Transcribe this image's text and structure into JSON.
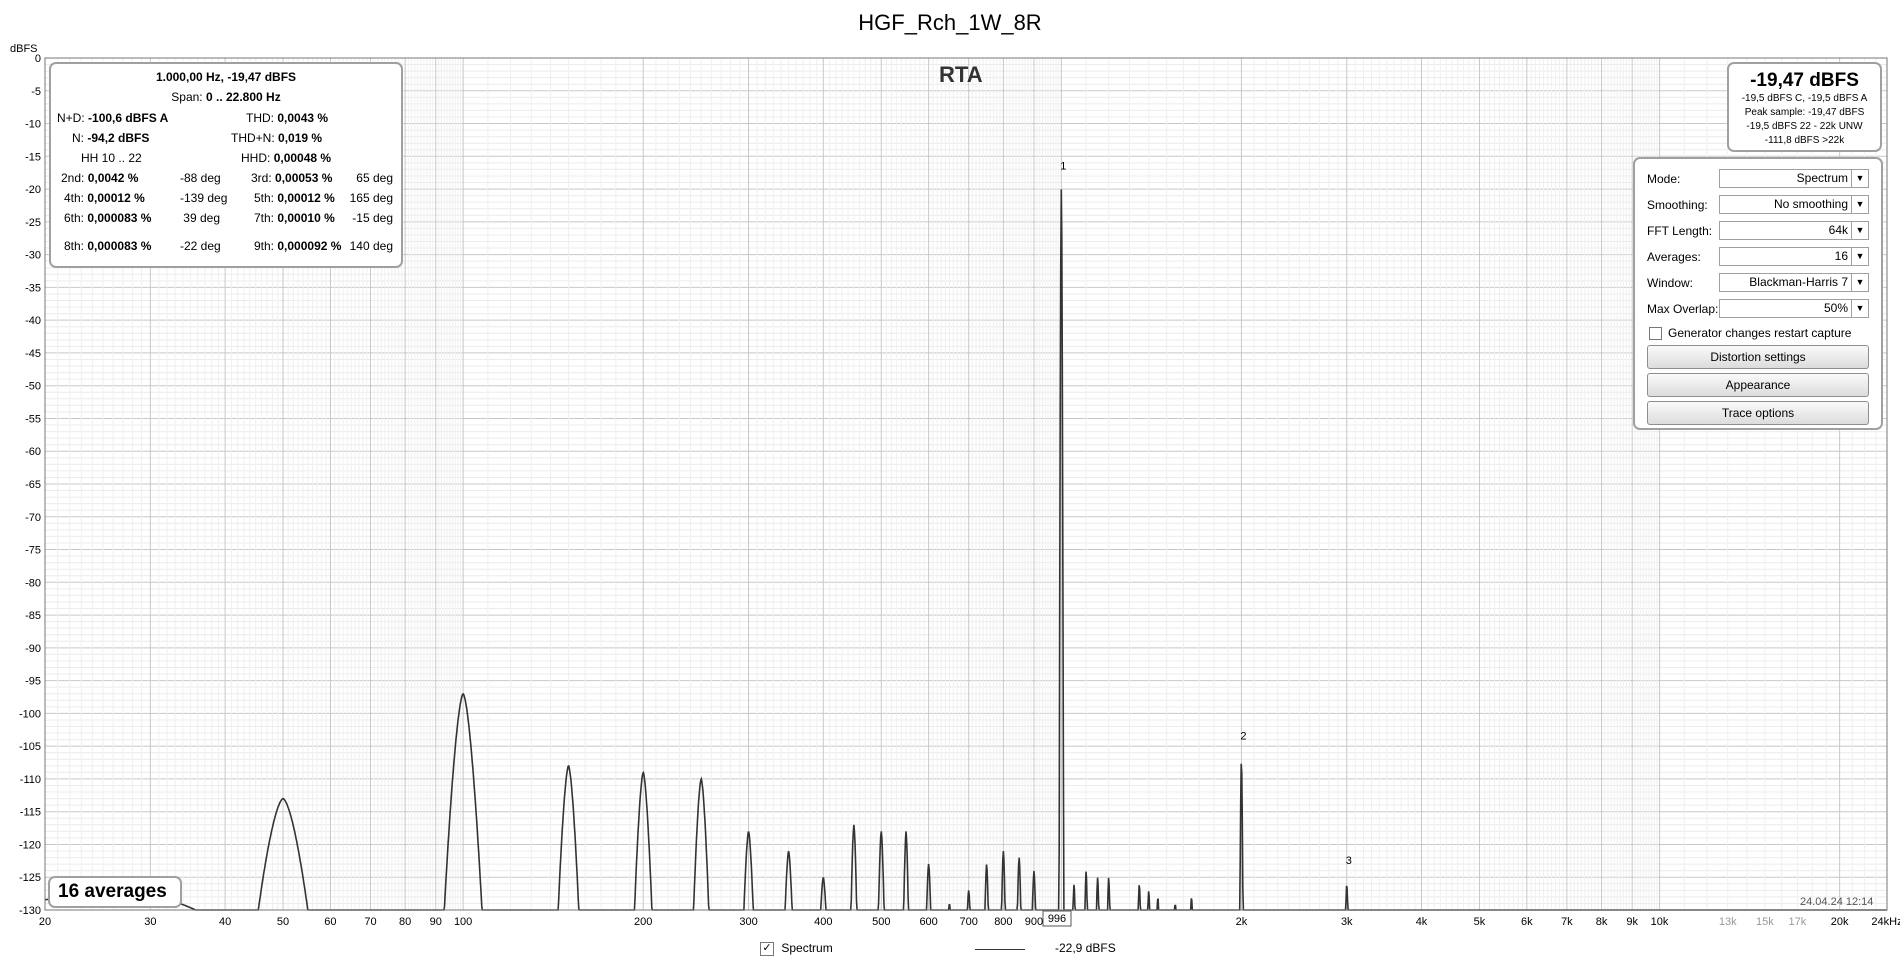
{
  "title": "HGF_Rch_1W_8R",
  "rta_label": "RTA",
  "date": "24.04.24 12:14",
  "averages_label": "16 averages",
  "cursor_value": "996",
  "info": {
    "header": "1.000,00 Hz, -19,47 dBFS",
    "span_label": "Span:",
    "span_value": "0 .. 22.800 Hz",
    "nd_label": "N+D:",
    "nd_value": "-100,6 dBFS A",
    "thd_label": "THD:",
    "thd_value": "0,0043 %",
    "n_label": "N:",
    "n_value": "-94,2 dBFS",
    "thdn_label": "THD+N:",
    "thdn_value": "0,019 %",
    "hh_label": "HH 10 .. 22",
    "hhd_label": "HHD:",
    "hhd_value": "0,00048 %",
    "harmonics": [
      {
        "label": "2nd:",
        "value": "0,0042 %",
        "phase": "-88 deg"
      },
      {
        "label": "3rd:",
        "value": "0,00053 %",
        "phase": "65 deg"
      },
      {
        "label": "4th:",
        "value": "0,00012 %",
        "phase": "-139 deg"
      },
      {
        "label": "5th:",
        "value": "0,00012 %",
        "phase": "165 deg"
      },
      {
        "label": "6th:",
        "value": "0,000083 %",
        "phase": "39 deg"
      },
      {
        "label": "7th:",
        "value": "0,00010 %",
        "phase": "-15 deg"
      },
      {
        "label": "8th:",
        "value": "0,000083 %",
        "phase": "-22 deg"
      },
      {
        "label": "9th:",
        "value": "0,000092 %",
        "phase": "140 deg"
      }
    ]
  },
  "level": {
    "main": "-19,47 dBFS",
    "lines": [
      "-19,5 dBFS C, -19,5 dBFS A",
      "Peak sample: -19,47 dBFS",
      "-19,5 dBFS 22 - 22k UNW",
      "-111,8 dBFS >22k"
    ]
  },
  "controls": {
    "mode_label": "Mode:",
    "mode_value": "Spectrum",
    "smoothing_label": "Smoothing:",
    "smoothing_value": "No  smoothing",
    "fft_label": "FFT Length:",
    "fft_value": "64k",
    "averages_label": "Averages:",
    "averages_value": "16",
    "window_label": "Window:",
    "window_value": "Blackman-Harris 7",
    "overlap_label": "Max Overlap:",
    "overlap_value": "50%",
    "generator_label": "Generator changes restart capture",
    "distortion_button": "Distortion settings",
    "appearance_button": "Appearance",
    "trace_button": "Trace options"
  },
  "legend": {
    "name": "Spectrum",
    "value": "-22,9 dBFS"
  },
  "chart_data": {
    "type": "line",
    "title": "HGF_Rch_1W_8R",
    "ylabel": "dBFS",
    "xlabel": "",
    "xscale": "log",
    "xlim": [
      20,
      24000
    ],
    "ylim": [
      -130,
      0
    ],
    "yticks": [
      0,
      -5,
      -10,
      -15,
      -20,
      -25,
      -30,
      -35,
      -40,
      -45,
      -50,
      -55,
      -60,
      -65,
      -70,
      -75,
      -80,
      -85,
      -90,
      -95,
      -100,
      -105,
      -110,
      -115,
      -120,
      -125,
      -130
    ],
    "xticks": [
      {
        "v": 20,
        "l": "20"
      },
      {
        "v": 30,
        "l": "30"
      },
      {
        "v": 40,
        "l": "40"
      },
      {
        "v": 50,
        "l": "50"
      },
      {
        "v": 60,
        "l": "60"
      },
      {
        "v": 70,
        "l": "70"
      },
      {
        "v": 80,
        "l": "80"
      },
      {
        "v": 90,
        "l": "90"
      },
      {
        "v": 100,
        "l": "100"
      },
      {
        "v": 200,
        "l": "200"
      },
      {
        "v": 300,
        "l": "300"
      },
      {
        "v": 400,
        "l": "400"
      },
      {
        "v": 500,
        "l": "500"
      },
      {
        "v": 600,
        "l": "600"
      },
      {
        "v": 700,
        "l": "700"
      },
      {
        "v": 800,
        "l": "800"
      },
      {
        "v": 900,
        "l": "900"
      },
      {
        "v": 2000,
        "l": "2k"
      },
      {
        "v": 3000,
        "l": "3k"
      },
      {
        "v": 4000,
        "l": "4k"
      },
      {
        "v": 5000,
        "l": "5k"
      },
      {
        "v": 6000,
        "l": "6k"
      },
      {
        "v": 7000,
        "l": "7k"
      },
      {
        "v": 8000,
        "l": "8k"
      },
      {
        "v": 9000,
        "l": "9k"
      },
      {
        "v": 10000,
        "l": "10k"
      },
      {
        "v": 13000,
        "l": "13k"
      },
      {
        "v": 15000,
        "l": "15k"
      },
      {
        "v": 17000,
        "l": "17k"
      },
      {
        "v": 20000,
        "l": "20k"
      },
      {
        "v": 24000,
        "l": "24kHz"
      }
    ],
    "grid": true,
    "harmonic_markers": [
      {
        "f": 1000,
        "db": -17,
        "l": "1"
      },
      {
        "f": 2000,
        "db": -104,
        "l": "2"
      },
      {
        "f": 3000,
        "db": -123,
        "l": "3"
      }
    ],
    "series": [
      {
        "name": "Spectrum",
        "peaks": [
          {
            "f": 22,
            "db": -128,
            "w": 0.25
          },
          {
            "f": 30,
            "db": -128,
            "w": 0.18
          },
          {
            "f": 50,
            "db": -113,
            "w": 0.05
          },
          {
            "f": 100,
            "db": -97,
            "w": 0.035
          },
          {
            "f": 150,
            "db": -108,
            "w": 0.02
          },
          {
            "f": 200,
            "db": -109,
            "w": 0.017
          },
          {
            "f": 250,
            "db": -110,
            "w": 0.015
          },
          {
            "f": 300,
            "db": -118,
            "w": 0.01
          },
          {
            "f": 350,
            "db": -121,
            "w": 0.008
          },
          {
            "f": 400,
            "db": -125,
            "w": 0.007
          },
          {
            "f": 450,
            "db": -117,
            "w": 0.006
          },
          {
            "f": 500,
            "db": -118,
            "w": 0.006
          },
          {
            "f": 550,
            "db": -118,
            "w": 0.005
          },
          {
            "f": 600,
            "db": -123,
            "w": 0.005
          },
          {
            "f": 650,
            "db": -129,
            "w": 0.004
          },
          {
            "f": 700,
            "db": -127,
            "w": 0.004
          },
          {
            "f": 750,
            "db": -123,
            "w": 0.004
          },
          {
            "f": 800,
            "db": -121,
            "w": 0.004
          },
          {
            "f": 850,
            "db": -122,
            "w": 0.004
          },
          {
            "f": 900,
            "db": -124,
            "w": 0.004
          },
          {
            "f": 1000,
            "db": -19.5,
            "w": 0.004
          },
          {
            "f": 1050,
            "db": -126,
            "w": 0.003
          },
          {
            "f": 1100,
            "db": -124,
            "w": 0.003
          },
          {
            "f": 1150,
            "db": -125,
            "w": 0.003
          },
          {
            "f": 1200,
            "db": -125,
            "w": 0.003
          },
          {
            "f": 1350,
            "db": -126,
            "w": 0.003
          },
          {
            "f": 1400,
            "db": -127,
            "w": 0.003
          },
          {
            "f": 1450,
            "db": -128,
            "w": 0.003
          },
          {
            "f": 1550,
            "db": -129,
            "w": 0.003
          },
          {
            "f": 1650,
            "db": -128,
            "w": 0.003
          },
          {
            "f": 2000,
            "db": -107,
            "w": 0.003
          },
          {
            "f": 3000,
            "db": -126,
            "w": 0.003
          }
        ]
      }
    ]
  }
}
